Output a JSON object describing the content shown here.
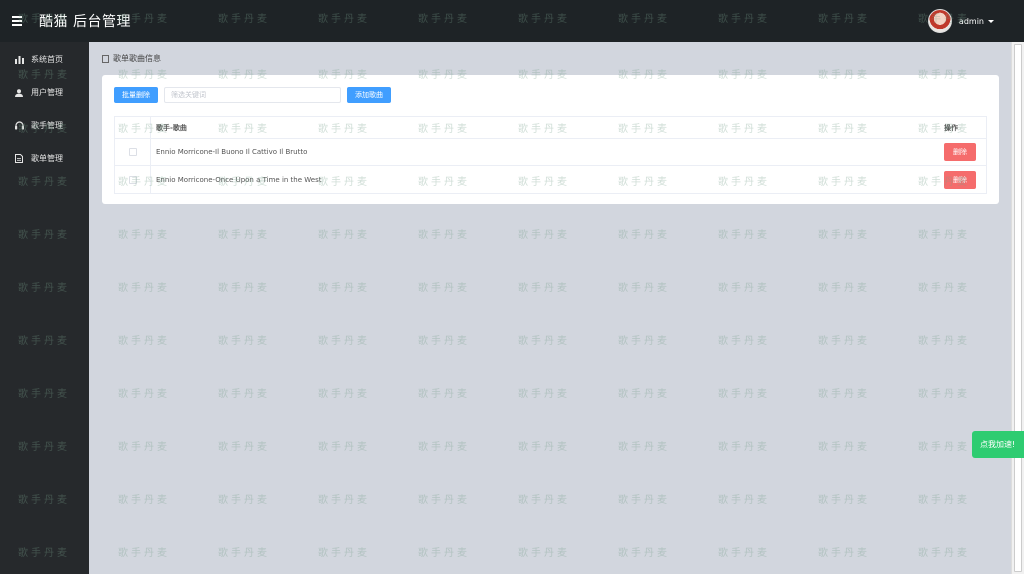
{
  "header": {
    "title": "酷猫 后台管理",
    "user": "admin"
  },
  "sidebar": {
    "items": [
      {
        "label": "系统首页",
        "icon": "bar-chart-icon"
      },
      {
        "label": "用户管理",
        "icon": "user-icon"
      },
      {
        "label": "歌手管理",
        "icon": "headphones-icon"
      },
      {
        "label": "歌单管理",
        "icon": "document-icon"
      }
    ]
  },
  "breadcrumb": "歌单歌曲信息",
  "toolbar": {
    "batch_delete": "批量删除",
    "search_placeholder": "筛选关键词",
    "add_song": "添加歌曲"
  },
  "table": {
    "headers": {
      "name": "歌手-歌曲",
      "op": "操作"
    },
    "rows": [
      {
        "name": "Ennio Morricone-Il Buono Il Cattivo Il Brutto",
        "op": "删除"
      },
      {
        "name": "Ennio Morricone-Once Upon a Time in the West",
        "op": "删除"
      }
    ]
  },
  "watermark": "歌手丹麦",
  "float_button": "点我加速!",
  "colors": {
    "primary": "#409eff",
    "danger": "#f56c6c",
    "success": "#2ecc71",
    "sidebar": "#26292c",
    "header": "#1e2326"
  }
}
